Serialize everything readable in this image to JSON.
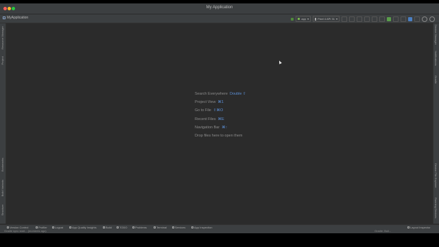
{
  "window": {
    "title": "My Application"
  },
  "navbar": {
    "project_name": "MyApplication",
    "run_config": "app",
    "device": "Pixel 4 API 31"
  },
  "left_tabs": [
    "Resource Manager",
    "Project",
    "Bookmarks",
    "Build Variants",
    "Structure"
  ],
  "right_tabs": [
    "Device Manager",
    "Notifications",
    "Gradle",
    "Device File Explorer",
    "Running Devices"
  ],
  "hints": [
    {
      "label": "Search Everywhere",
      "shortcut": "Double ⇧"
    },
    {
      "label": "Project View",
      "shortcut": "⌘1"
    },
    {
      "label": "Go to File",
      "shortcut": "⇧⌘O"
    },
    {
      "label": "Recent Files",
      "shortcut": "⌘E"
    },
    {
      "label": "Navigation Bar",
      "shortcut": "⌘↑"
    },
    {
      "label": "Drop files here to open them",
      "shortcut": ""
    }
  ],
  "bottom_tabs": [
    "Version Control",
    "Profiler",
    "Logcat",
    "App Quality Insights",
    "Build",
    "TODO",
    "Problems",
    "Terminal",
    "Services",
    "App Inspection"
  ],
  "bottom_right_tab": "Layout Inspector",
  "status": {
    "left": "Gradle sync start... (moments ago)",
    "right": "Gradle: Buil..."
  },
  "colors": {
    "accent": "#5c8fd6",
    "background": "#2b2b2b",
    "panel": "#3c3f41"
  }
}
